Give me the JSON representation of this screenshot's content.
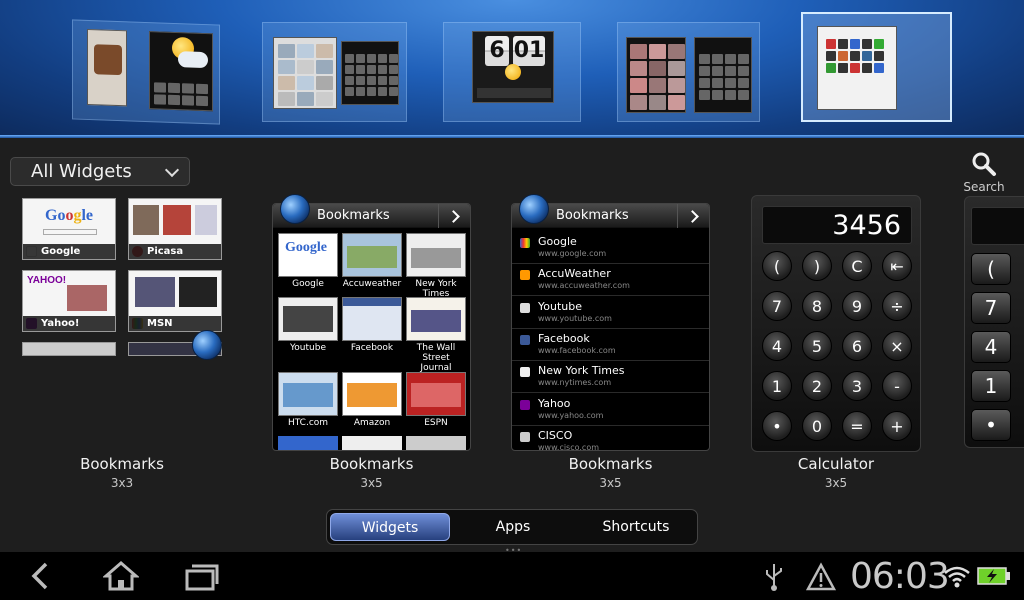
{
  "widget_picker": {
    "filter_selected": "All Widgets",
    "search_label": "Search"
  },
  "widgets": [
    {
      "label": "Bookmarks",
      "size": "3x3",
      "thumbs": [
        "Google",
        "Picasa",
        "Yahoo!",
        "MSN"
      ]
    },
    {
      "label": "Bookmarks",
      "size": "3x5",
      "header": "Bookmarks",
      "grid": [
        "Google",
        "Accuweather",
        "New York Times",
        "Youtube",
        "Facebook",
        "The Wall Street Journal",
        "HTC.com",
        "Amazon",
        "ESPN"
      ]
    },
    {
      "label": "Bookmarks",
      "size": "3x5",
      "header": "Bookmarks",
      "list": [
        {
          "name": "Google",
          "url": "www.google.com"
        },
        {
          "name": "AccuWeather",
          "url": "www.accuweather.com"
        },
        {
          "name": "Youtube",
          "url": "www.youtube.com"
        },
        {
          "name": "Facebook",
          "url": "www.facebook.com"
        },
        {
          "name": "New York Times",
          "url": "www.nytimes.com"
        },
        {
          "name": "Yahoo",
          "url": "www.yahoo.com"
        },
        {
          "name": "CISCO",
          "url": "www.cisco.com"
        }
      ]
    },
    {
      "label": "Calculator",
      "size": "3x5",
      "display": "3456",
      "keys": [
        "(",
        ")",
        "C",
        "⇤",
        "7",
        "8",
        "9",
        "÷",
        "4",
        "5",
        "6",
        "×",
        "1",
        "2",
        "3",
        "-",
        "•",
        "0",
        "=",
        "+"
      ]
    }
  ],
  "calc_partial": {
    "keys": [
      "(",
      "7",
      "4",
      "1",
      "•"
    ]
  },
  "top_panels": {
    "clock_digits": [
      "6",
      "01"
    ]
  },
  "tabs": [
    {
      "label": "Widgets",
      "active": true
    },
    {
      "label": "Apps",
      "active": false
    },
    {
      "label": "Shortcuts",
      "active": false
    }
  ],
  "status_bar": {
    "time": "06:03",
    "icons": [
      "usb-icon",
      "warning-icon",
      "wifi-icon",
      "battery-charging-icon"
    ]
  },
  "colors": {
    "top_strip": "#1f5fb8",
    "active_tab": "#4a68b8",
    "widget_bg": "#1e1e1e"
  }
}
